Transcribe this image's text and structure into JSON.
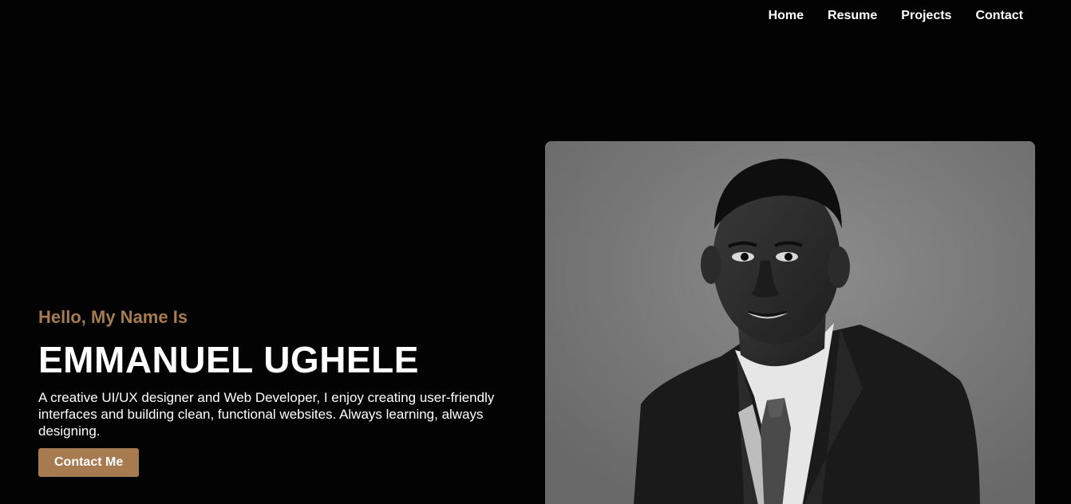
{
  "nav": {
    "items": [
      {
        "label": "Home"
      },
      {
        "label": "Resume"
      },
      {
        "label": "Projects"
      },
      {
        "label": "Contact"
      }
    ]
  },
  "hero": {
    "greeting": "Hello, My Name Is",
    "name": "EMMANUEL UGHELE",
    "bio": "A creative UI/UX designer and Web Developer, I enjoy creating user-friendly interfaces and building clean, functional websites. Always learning, always designing.",
    "cta_label": "Contact Me"
  },
  "colors": {
    "background": "#030303",
    "accent": "#a77a4f",
    "text": "#ffffff"
  }
}
